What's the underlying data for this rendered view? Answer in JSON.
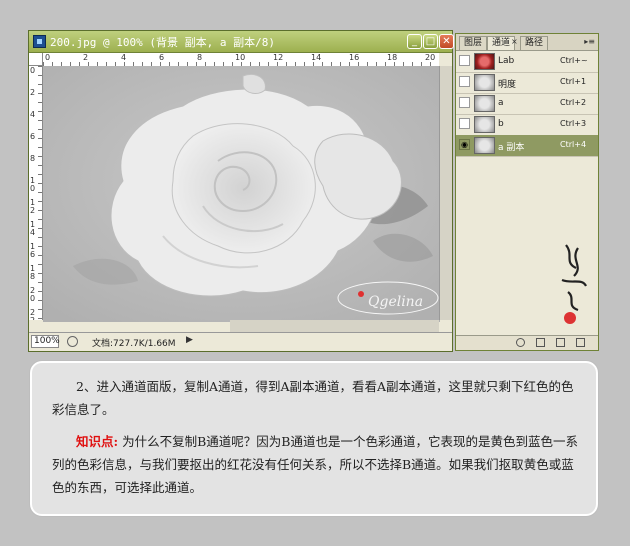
{
  "document_window": {
    "title": "200.jpg @ 100% (背景 副本, a 副本/8)",
    "window_buttons": [
      "minimize-icon",
      "maximize-icon",
      "close-icon"
    ],
    "ruler_top_ticks": [
      "0",
      "2",
      "4",
      "6",
      "8",
      "10",
      "12",
      "14",
      "16",
      "18",
      "20"
    ],
    "ruler_left_ticks": [
      "0",
      "2",
      "4",
      "6",
      "8",
      "1\n0",
      "1\n2",
      "1\n4",
      "1\n6",
      "1\n8",
      "2\n0",
      "2\n2"
    ],
    "status": {
      "zoom": "100%",
      "doc_info": "文档:727.7K/1.66M",
      "arrow": "▶"
    },
    "signature_text": "Qgelina"
  },
  "channels_panel": {
    "tabs": [
      "图层",
      "通道",
      "路径"
    ],
    "active_tab": "通道",
    "channels": [
      {
        "name": "Lab",
        "shortcut": "Ctrl+~",
        "visible": false,
        "thumb": "color"
      },
      {
        "name": "明度",
        "shortcut": "Ctrl+1",
        "visible": false,
        "thumb": "gray"
      },
      {
        "name": "a",
        "shortcut": "Ctrl+2",
        "visible": false,
        "thumb": "gray"
      },
      {
        "name": "b",
        "shortcut": "Ctrl+3",
        "visible": false,
        "thumb": "gray"
      },
      {
        "name": "a 副本",
        "shortcut": "Ctrl+4",
        "visible": true,
        "thumb": "gray",
        "selected": true
      }
    ],
    "footer_icons": [
      "load-selection-icon",
      "save-selection-icon",
      "new-channel-icon",
      "delete-channel-icon"
    ]
  },
  "instructions": {
    "paragraph1": "2、进入通道面版，复制A通道，得到A副本通道，看看A副本通道，这里就只剩下红色的色彩信息了。",
    "knowledge_label": "知识点:",
    "paragraph2": "为什么不复制B通道呢？因为B通道也是一个色彩通道，它表现的是黄色到蓝色一系列的色彩信息，与我们要抠出的红花没有任何关系，所以不选择B通道。如果我们抠取黄色或蓝色的东西，可选择此通道。"
  },
  "colors": {
    "titlebar": "#a9bb5c",
    "selected_row": "#8f9a62",
    "knowledge_label": "#e01010",
    "canvas_bg": "#b8b8b8"
  }
}
